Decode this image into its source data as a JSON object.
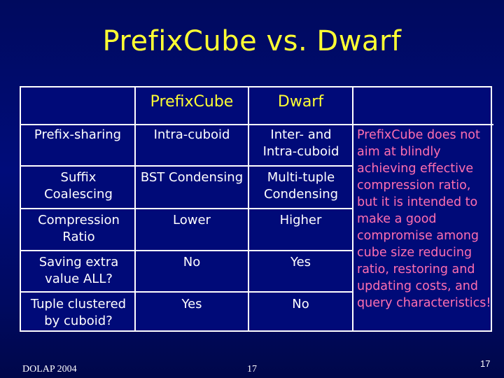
{
  "slide": {
    "title": "PrefixCube vs. Dwarf",
    "colors": {
      "background": "#000a78",
      "title": "#ffff33",
      "table_text": "#ffffff",
      "note_text": "#ff6fb0",
      "border": "#ffffff"
    }
  },
  "table": {
    "headers": [
      "",
      "PrefixCube",
      "Dwarf"
    ],
    "rows": [
      {
        "label": "Prefix-sharing",
        "prefixcube": "Intra-cuboid",
        "dwarf": "Inter- and Intra-cuboid"
      },
      {
        "label": "Suffix Coalescing",
        "prefixcube": "BST Condensing",
        "dwarf": "Multi-tuple Condensing"
      },
      {
        "label": "Compression Ratio",
        "prefixcube": "Lower",
        "dwarf": "Higher"
      },
      {
        "label": "Saving extra value ALL?",
        "prefixcube": "No",
        "dwarf": "Yes"
      },
      {
        "label": "Tuple clustered by cuboid?",
        "prefixcube": "Yes",
        "dwarf": "No"
      }
    ]
  },
  "note": "PrefixCube does not aim at blindly achieving effective compression ratio, but it is intended to make a good compromise among cube size reducing ratio, restoring and updating costs, and query characteristics!",
  "footer": {
    "left": "DOLAP 2004",
    "center": "17",
    "right": "17"
  }
}
